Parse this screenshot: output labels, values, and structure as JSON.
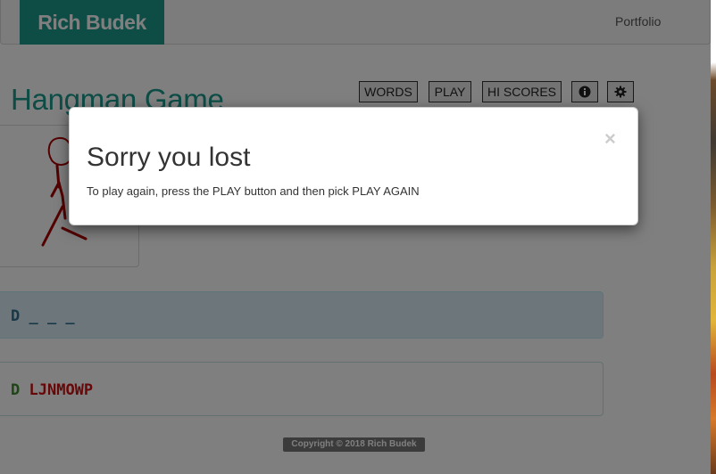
{
  "navbar": {
    "brand": "Rich Budek",
    "links": [
      "Portfolio"
    ]
  },
  "page": {
    "title": "Hangman Game"
  },
  "toolbar": {
    "words_label": "WORDS",
    "play_label": "PLAY",
    "hi_scores_label": "HI SCORES",
    "info_icon": "info-circle-icon",
    "settings_icon": "gear-icon"
  },
  "game": {
    "word_display": "D _ _ _",
    "correct_guesses": "D",
    "wrong_guesses": "LJNMOWP",
    "hangman_color": "#aa0000"
  },
  "footer": {
    "copyright": "Copyright © 2018 Rich Budek"
  },
  "modal": {
    "title": "Sorry you lost",
    "body": "To play again, press the PLAY button and then pick PLAY AGAIN",
    "close": "×"
  },
  "colors": {
    "accent": "#1b9a8c",
    "word_panel_bg": "#d9edf7",
    "correct": "#3a8a2a",
    "wrong": "#cc1111"
  }
}
